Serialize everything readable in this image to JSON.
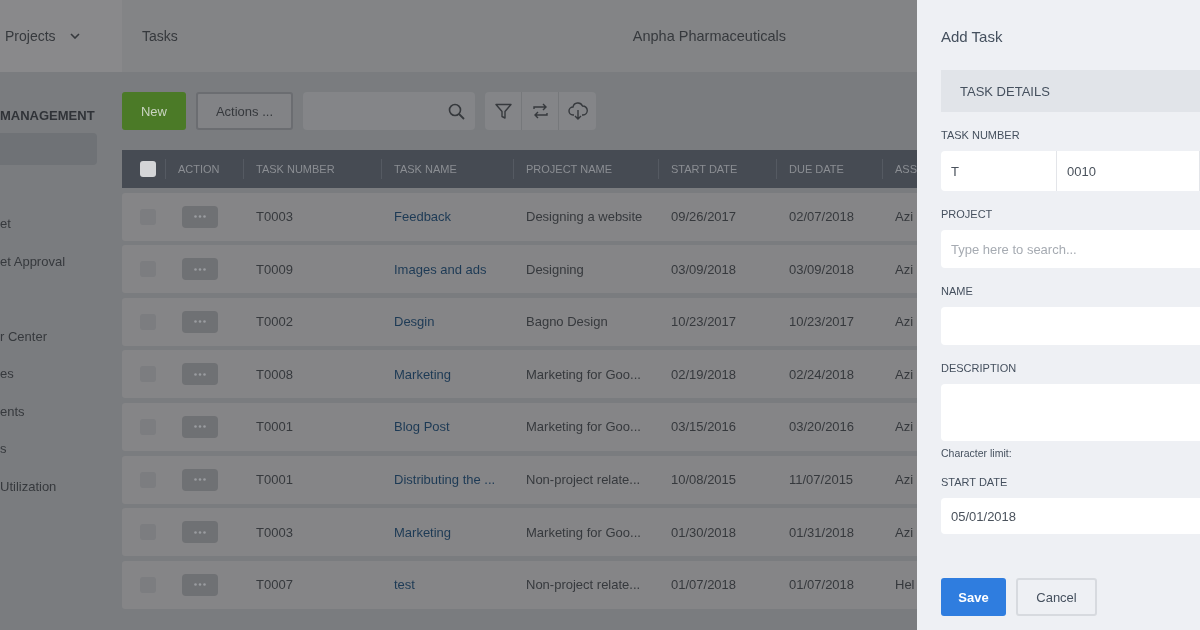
{
  "nav": {
    "menu": "Projects",
    "breadcrumb": "Tasks",
    "company": "Anpha Pharmaceuticals"
  },
  "sidebar": {
    "heading": "MANAGEMENT",
    "items": [
      {
        "selected": true
      },
      {
        "label": "et",
        "selected": false
      },
      {
        "label": "et Approval",
        "selected": false
      },
      {
        "selected": false
      },
      {
        "label": "r Center",
        "selected": false
      },
      {
        "label": "es",
        "selected": false
      },
      {
        "label": "ents",
        "selected": false
      },
      {
        "label": "s",
        "selected": false
      },
      {
        "label": "Utilization",
        "selected": false
      }
    ]
  },
  "toolbar": {
    "new_button": "New",
    "actions_button": "Actions ..."
  },
  "table": {
    "header_checked": false,
    "columns": [
      "ACTION",
      "TASK NUMBER",
      "TASK NAME",
      "PROJECT NAME",
      "START DATE",
      "DUE DATE",
      "ASS"
    ],
    "rows": [
      {
        "checked": false,
        "number": "T0003",
        "name": "Feedback",
        "project": "Designing a website",
        "start": "09/26/2017",
        "due": "02/07/2018",
        "assignee": "Azi"
      },
      {
        "checked": false,
        "number": "T0009",
        "name": "Images and ads",
        "project": "Designing",
        "start": "03/09/2018",
        "due": "03/09/2018",
        "assignee": "Azi"
      },
      {
        "checked": false,
        "number": "T0002",
        "name": "Desgin",
        "project": "Bagno Design",
        "start": "10/23/2017",
        "due": "10/23/2017",
        "assignee": "Azi"
      },
      {
        "checked": false,
        "number": "T0008",
        "name": "Marketing",
        "project": "Marketing for Goo...",
        "start": "02/19/2018",
        "due": "02/24/2018",
        "assignee": "Azi"
      },
      {
        "checked": false,
        "number": "T0001",
        "name": "Blog Post",
        "project": "Marketing for Goo...",
        "start": "03/15/2016",
        "due": "03/20/2016",
        "assignee": "Azi"
      },
      {
        "checked": false,
        "number": "T0001",
        "name": "Distributing the ...",
        "project": "Non-project relate...",
        "start": "10/08/2015",
        "due": "11/07/2015",
        "assignee": "Azi"
      },
      {
        "checked": false,
        "number": "T0003",
        "name": "Marketing",
        "project": "Marketing for Goo...",
        "start": "01/30/2018",
        "due": "01/31/2018",
        "assignee": "Azi"
      },
      {
        "checked": false,
        "number": "T0007",
        "name": "test",
        "project": "Non-project relate...",
        "start": "01/07/2018",
        "due": "01/07/2018",
        "assignee": "Hel"
      }
    ]
  },
  "panel": {
    "title": "Add Task",
    "section": "TASK DETAILS",
    "fields": [
      {
        "kind": "split",
        "label": "TASK NUMBER",
        "prefix": "T",
        "value": "0010"
      },
      {
        "kind": "text",
        "label": "PROJECT",
        "placeholder": "Type here to search..."
      },
      {
        "kind": "text",
        "label": "NAME"
      },
      {
        "kind": "textarea",
        "label": "DESCRIPTION",
        "hint": "Character limit:"
      },
      {
        "kind": "text",
        "label": "START DATE",
        "value": "05/01/2018"
      }
    ],
    "save_button": "Save",
    "cancel_button": "Cancel"
  }
}
